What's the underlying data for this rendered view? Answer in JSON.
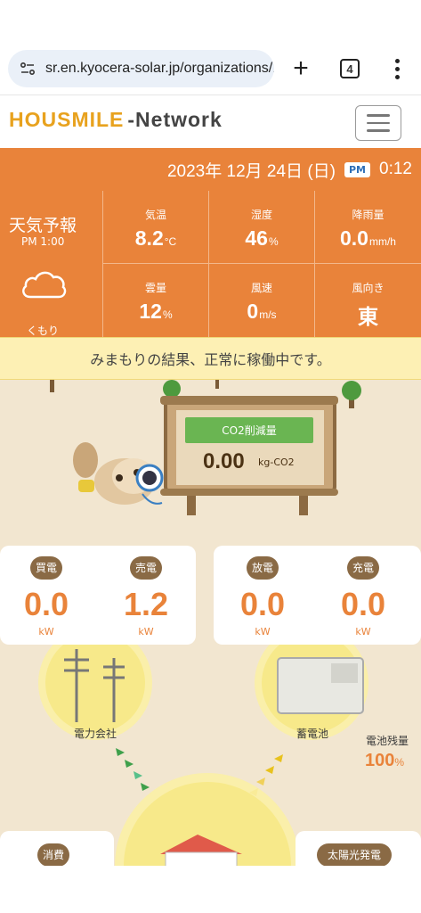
{
  "browser": {
    "url": "sr.en.kyocera-solar.jp/organizations/1",
    "tab_count": "4"
  },
  "header": {
    "logo_main": "HOUSMILE",
    "logo_sub": "-Network"
  },
  "date_bar": {
    "date": "2023年 12月 24日 (日)",
    "ampm": "PM",
    "time": "0:12"
  },
  "weather": {
    "title": "天気予報",
    "time": "PM 1:00",
    "condition": "くもり",
    "temperature": {
      "label": "気温",
      "value": "8.2",
      "unit": "°C"
    },
    "humidity": {
      "label": "湿度",
      "value": "46",
      "unit": "%"
    },
    "rainfall": {
      "label": "降雨量",
      "value": "0.0",
      "unit": "mm/h"
    },
    "cloud_cover": {
      "label": "雲量",
      "value": "12",
      "unit": "%"
    },
    "wind_speed": {
      "label": "風速",
      "value": "0",
      "unit": "m/s"
    },
    "wind_direction": {
      "label": "風向き",
      "value": "東"
    }
  },
  "status_message": "みまもりの結果、正常に稼働中です。",
  "co2": {
    "label": "CO2削減量",
    "value": "0.00",
    "unit": "kg-CO2"
  },
  "power": {
    "buy": {
      "label": "買電",
      "value": "0.0",
      "unit": "kW"
    },
    "sell": {
      "label": "売電",
      "value": "1.2",
      "unit": "kW"
    },
    "discharge": {
      "label": "放電",
      "value": "0.0",
      "unit": "kW"
    },
    "charge": {
      "label": "充電",
      "value": "0.0",
      "unit": "kW"
    }
  },
  "nodes": {
    "power_company": "電力会社",
    "battery": "蓄電池",
    "battery_level_label": "電池残量",
    "battery_level": "100",
    "battery_level_unit": "%",
    "consumption": "消費",
    "solar": "太陽光発電"
  },
  "colors": {
    "accent_orange": "#e9833a",
    "banner_yellow": "#fdf0b4",
    "label_brown": "#8a6a45",
    "co2_green": "#6ab552"
  }
}
